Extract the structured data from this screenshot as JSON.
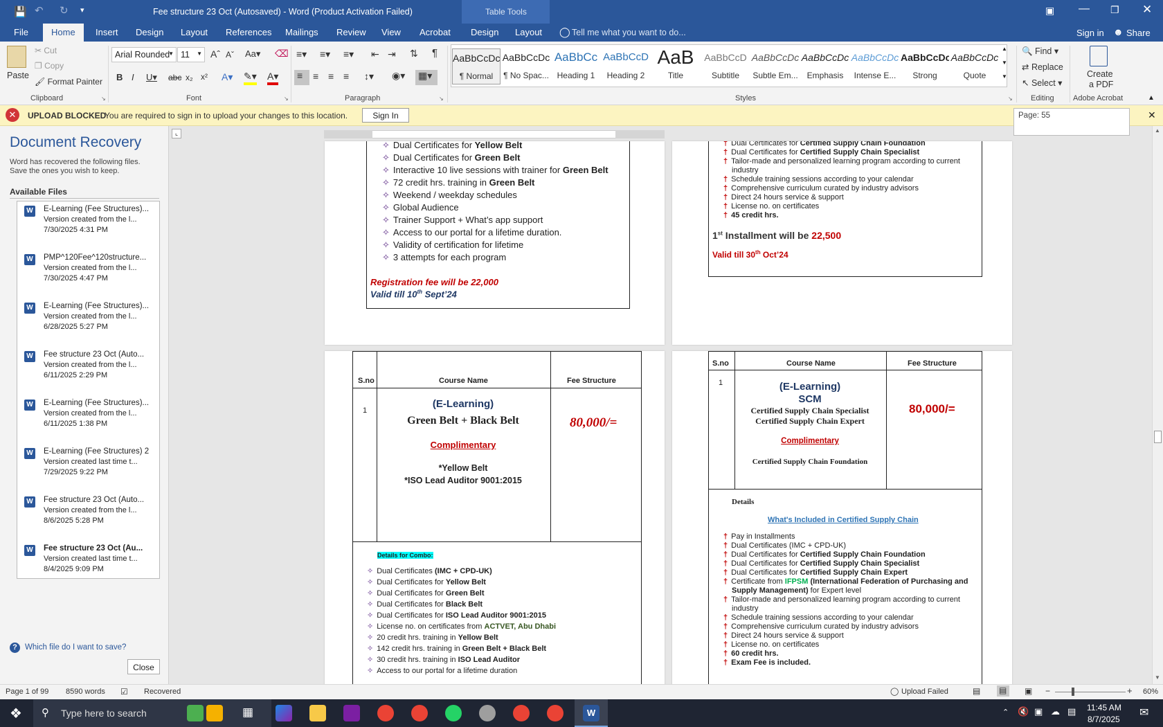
{
  "window": {
    "title": "Fee structure 23 Oct (Autosaved) - Word (Product Activation Failed)",
    "table_tools": "Table Tools"
  },
  "tabs": [
    "File",
    "Home",
    "Insert",
    "Design",
    "Layout",
    "References",
    "Mailings",
    "Review",
    "View",
    "Acrobat",
    "Design",
    "Layout"
  ],
  "tell_me": "Tell me what you want to do...",
  "sign_in": "Sign in",
  "share": "Share",
  "ribbon": {
    "clipboard": {
      "paste": "Paste",
      "cut": "Cut",
      "copy": "Copy",
      "format_painter": "Format Painter",
      "label": "Clipboard"
    },
    "font": {
      "family": "Arial Rounded",
      "size": "11",
      "label": "Font"
    },
    "paragraph": {
      "label": "Paragraph"
    },
    "styles": {
      "label": "Styles",
      "items": [
        {
          "preview": "AaBbCcDc",
          "name": "¶ Normal"
        },
        {
          "preview": "AaBbCcDc",
          "name": "¶ No Spac..."
        },
        {
          "preview": "AaBbCc",
          "name": "Heading 1"
        },
        {
          "preview": "AaBbCcD",
          "name": "Heading 2"
        },
        {
          "preview": "AaB",
          "name": "Title"
        },
        {
          "preview": "AaBbCcD",
          "name": "Subtitle"
        },
        {
          "preview": "AaBbCcDc",
          "name": "Subtle Em..."
        },
        {
          "preview": "AaBbCcDc",
          "name": "Emphasis"
        },
        {
          "preview": "AaBbCcDc",
          "name": "Intense E..."
        },
        {
          "preview": "AaBbCcDc",
          "name": "Strong"
        },
        {
          "preview": "AaBbCcDc",
          "name": "Quote"
        }
      ]
    },
    "editing": {
      "find": "Find",
      "replace": "Replace",
      "select": "Select",
      "label": "Editing"
    },
    "acrobat": {
      "create": "Create",
      "pdf": "a PDF",
      "label": "Adobe Acrobat"
    }
  },
  "message_bar": {
    "title": "UPLOAD BLOCKED",
    "text": "You are required to sign in to upload your changes to this location.",
    "button": "Sign In",
    "page_tooltip": "Page: 55"
  },
  "recovery": {
    "title": "Document Recovery",
    "desc1": "Word has recovered the following files.",
    "desc2": "Save the ones you wish to keep.",
    "available": "Available Files",
    "files": [
      {
        "name": "E-Learning (Fee Structures)...",
        "desc": "Version created from the l...",
        "date": "7/30/2025 4:31 PM"
      },
      {
        "name": "PMP^120Fee^120structure...",
        "desc": "Version created from the l...",
        "date": "7/30/2025 4:47 PM"
      },
      {
        "name": "E-Learning (Fee Structures)...",
        "desc": "Version created from the l...",
        "date": "6/28/2025 5:27 PM"
      },
      {
        "name": "Fee structure 23 Oct (Auto...",
        "desc": "Version created from the l...",
        "date": "6/11/2025 2:29 PM"
      },
      {
        "name": "E-Learning (Fee Structures)...",
        "desc": "Version created from the l...",
        "date": "6/11/2025 1:38 PM"
      },
      {
        "name": "E-Learning (Fee Structures) 2",
        "desc": "Version created last time t...",
        "date": "7/29/2025 9:22 PM"
      },
      {
        "name": "Fee structure 23 Oct (Auto...",
        "desc": "Version created from the l...",
        "date": "8/6/2025 5:28 PM"
      },
      {
        "name": "Fee structure 23 Oct (Au...",
        "desc": "Version created last time t...",
        "date": "8/4/2025 9:09 PM"
      }
    ],
    "help": "Which file do I want to save?",
    "close": "Close"
  },
  "page1": {
    "bullets": [
      [
        "Dual Certificates for ",
        "Yellow Belt"
      ],
      [
        "Dual Certificates for ",
        "Green Belt"
      ],
      [
        "Interactive 10 live sessions with trainer for ",
        "Green Belt"
      ],
      [
        "72 credit hrs. training in ",
        "Green Belt"
      ],
      [
        "Weekend / weekday schedules",
        ""
      ],
      [
        "Global Audience",
        ""
      ],
      [
        "Trainer Support + What’s app support",
        ""
      ],
      [
        "Access to our portal for a lifetime duration.",
        ""
      ],
      [
        "Validity of certification for lifetime",
        ""
      ],
      [
        "3 attempts for each program",
        ""
      ]
    ],
    "reg_fee": "Registration fee will be 22,000",
    "valid_pre": "Valid till 10",
    "valid_sup": "th",
    "valid_post": " Sept’24"
  },
  "page2": {
    "bullets": [
      [
        "Dual Certificates for ",
        "Certified Supply Chain Foundation"
      ],
      [
        "Dual Certificates for ",
        "Certified Supply Chain Specialist"
      ],
      [
        "Tailor-made and personalized learning program according to current",
        ""
      ],
      [
        "industry",
        ""
      ],
      [
        "Schedule training sessions according to your calendar",
        ""
      ],
      [
        "Comprehensive curriculum curated by industry advisors",
        ""
      ],
      [
        "Direct 24 hours service & support",
        ""
      ],
      [
        "License no. on certificates",
        ""
      ],
      [
        "",
        "45 credit hrs."
      ]
    ],
    "inst_1": "1",
    "inst_sup": "st",
    "inst_text": " Installment will be ",
    "inst_amt": "22,500",
    "valid_pre": "Valid till 30",
    "valid_sup": "th",
    "valid_post": " Oct’24"
  },
  "page3": {
    "h_sno": "S.no",
    "h_course": "Course Name",
    "h_fee": "Fee Structure",
    "sno": "1",
    "elearning": "(E-Learning)",
    "course": "Green Belt + Black Belt",
    "fee": "80,000/=",
    "complimentary": "Complimentary",
    "comp1": "*Yellow Belt",
    "comp2": "*ISO Lead Auditor 9001:2015",
    "details": "Details for Combo:",
    "bullets": [
      [
        "Dual Certificates ",
        "(IMC + CPD-UK)",
        ""
      ],
      [
        "Dual Certificates for ",
        "Yellow Belt",
        ""
      ],
      [
        "Dual Certificates for ",
        "Green Belt",
        ""
      ],
      [
        "Dual Certificates for ",
        "Black Belt",
        ""
      ],
      [
        "Dual Certificates for ",
        "ISO Lead Auditor 9001:2015",
        ""
      ],
      [
        "License no. on certificates from ",
        "",
        "ACTVET, Abu Dhabi"
      ],
      [
        "20 credit hrs. training in ",
        "Yellow Belt",
        ""
      ],
      [
        "142 credit hrs. training in ",
        "Green Belt + Black Belt",
        ""
      ],
      [
        "30 credit hrs. training in ",
        "ISO Lead Auditor",
        ""
      ],
      [
        "Access to our portal for a lifetime duration",
        "",
        ""
      ]
    ]
  },
  "page4": {
    "h_sno": "S.no",
    "h_course": "Course Name",
    "h_fee": "Fee Structure",
    "sno": "1",
    "elearning": "(E-Learning)",
    "scm": "SCM",
    "c1": "Certified Supply Chain Specialist",
    "c2": "Certified Supply Chain Expert",
    "fee": "80,000/=",
    "complimentary": "Complimentary",
    "comp1": "Certified Supply Chain Foundation",
    "details": "Details",
    "included": "What's Included in Certified Supply Chain",
    "bullets": [
      [
        "Pay in Installments",
        "",
        ""
      ],
      [
        "Dual Certificates (IMC + CPD-UK)",
        "",
        ""
      ],
      [
        "Dual Certificates for ",
        "Certified Supply Chain Foundation",
        ""
      ],
      [
        "Dual Certificates for ",
        "Certified Supply Chain Specialist",
        ""
      ],
      [
        "Dual Certificates for ",
        "Certified Supply Chain Expert",
        ""
      ],
      [
        "Certificate from ",
        "",
        "IFPSM"
      ],
      [
        "",
        "Supply Management)",
        " for Expert level"
      ],
      [
        "Tailor-made and personalized learning program according to current",
        "",
        ""
      ],
      [
        "industry",
        "",
        ""
      ],
      [
        "Schedule training sessions according to your calendar",
        "",
        ""
      ],
      [
        "Comprehensive curriculum curated by industry advisors",
        "",
        ""
      ],
      [
        "Direct 24 hours service & support",
        "",
        ""
      ],
      [
        "License no. on certificates",
        "",
        ""
      ],
      [
        "",
        "60 credit hrs.",
        ""
      ],
      [
        "",
        "Exam Fee is included.",
        ""
      ]
    ],
    "ifpsm_rest": " (International Federation of Purchasing and"
  },
  "status": {
    "page": "Page 1 of 99",
    "words": "8590 words",
    "recovered": "Recovered",
    "upload": "Upload Failed",
    "zoom": "60%"
  },
  "taskbar": {
    "search": "Type here to search",
    "time": "11:45 AM",
    "date": "8/7/2025"
  },
  "colors": {
    "accent": "#2b579a",
    "red": "#c00000",
    "navy": "#1f3864"
  }
}
